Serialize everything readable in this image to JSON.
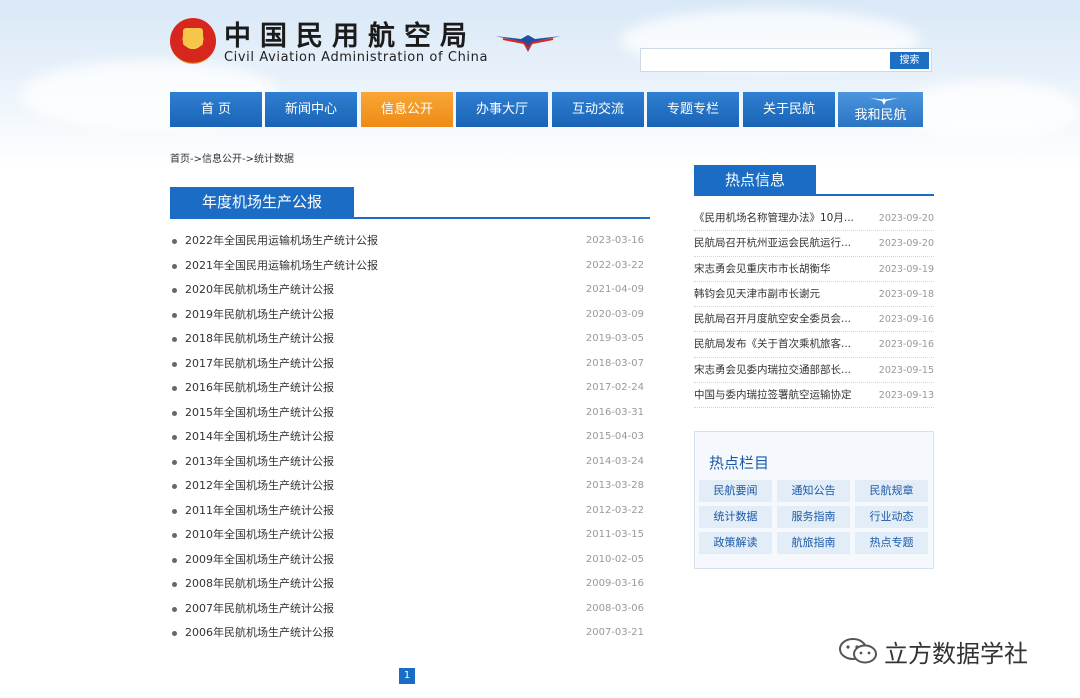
{
  "header": {
    "site_name_cn": "中国民用航空局",
    "site_name_en": "Civil Aviation Administration of China",
    "search_button": "搜索",
    "search_value": ""
  },
  "nav": [
    {
      "label": "首 页",
      "active": false
    },
    {
      "label": "新闻中心",
      "active": false
    },
    {
      "label": "信息公开",
      "active": true
    },
    {
      "label": "办事大厅",
      "active": false
    },
    {
      "label": "互动交流",
      "active": false
    },
    {
      "label": "专题专栏",
      "active": false
    },
    {
      "label": "关于民航",
      "active": false
    },
    {
      "label": "我和民航",
      "active": false
    }
  ],
  "breadcrumb": "首页->信息公开->统计数据",
  "section": {
    "title": "年度机场生产公报",
    "items": [
      {
        "title": "2022年全国民用运输机场生产统计公报",
        "date": "2023-03-16"
      },
      {
        "title": "2021年全国民用运输机场生产统计公报",
        "date": "2022-03-22"
      },
      {
        "title": "2020年民航机场生产统计公报",
        "date": "2021-04-09"
      },
      {
        "title": "2019年民航机场生产统计公报",
        "date": "2020-03-09"
      },
      {
        "title": "2018年民航机场生产统计公报",
        "date": "2019-03-05"
      },
      {
        "title": "2017年民航机场生产统计公报",
        "date": "2018-03-07"
      },
      {
        "title": "2016年民航机场生产统计公报",
        "date": "2017-02-24"
      },
      {
        "title": "2015年全国机场生产统计公报",
        "date": "2016-03-31"
      },
      {
        "title": "2014年全国机场生产统计公报",
        "date": "2015-04-03"
      },
      {
        "title": "2013年全国机场生产统计公报",
        "date": "2014-03-24"
      },
      {
        "title": "2012年全国机场生产统计公报",
        "date": "2013-03-28"
      },
      {
        "title": "2011年全国机场生产统计公报",
        "date": "2012-03-22"
      },
      {
        "title": "2010年全国机场生产统计公报",
        "date": "2011-03-15"
      },
      {
        "title": "2009年全国机场生产统计公报",
        "date": "2010-02-05"
      },
      {
        "title": "2008年民航机场生产统计公报",
        "date": "2009-03-16"
      },
      {
        "title": "2007年民航机场生产统计公报",
        "date": "2008-03-06"
      },
      {
        "title": "2006年民航机场生产统计公报",
        "date": "2007-03-21"
      }
    ]
  },
  "pagination": {
    "current": "1"
  },
  "hot_info": {
    "title": "热点信息",
    "items": [
      {
        "title": "《民用机场名称管理办法》10月...",
        "date": "2023-09-20"
      },
      {
        "title": "民航局召开杭州亚运会民航运行...",
        "date": "2023-09-20"
      },
      {
        "title": "宋志勇会见重庆市市长胡衡华",
        "date": "2023-09-19"
      },
      {
        "title": "韩钧会见天津市副市长谢元",
        "date": "2023-09-18"
      },
      {
        "title": "民航局召开月度航空安全委员会...",
        "date": "2023-09-16"
      },
      {
        "title": "民航局发布《关于首次乘机旅客...",
        "date": "2023-09-16"
      },
      {
        "title": "宋志勇会见委内瑞拉交通部部长...",
        "date": "2023-09-15"
      },
      {
        "title": "中国与委内瑞拉签署航空运输协定",
        "date": "2023-09-13"
      }
    ]
  },
  "hot_columns": {
    "title": "热点栏目",
    "items": [
      "民航要闻",
      "通知公告",
      "民航规章",
      "统计数据",
      "服务指南",
      "行业动态",
      "政策解读",
      "航旅指南",
      "热点专题"
    ]
  },
  "watermark": {
    "text": "立方数据学社"
  },
  "colors": {
    "primary": "#1a6cc4",
    "active_nav": "#f39a22"
  }
}
